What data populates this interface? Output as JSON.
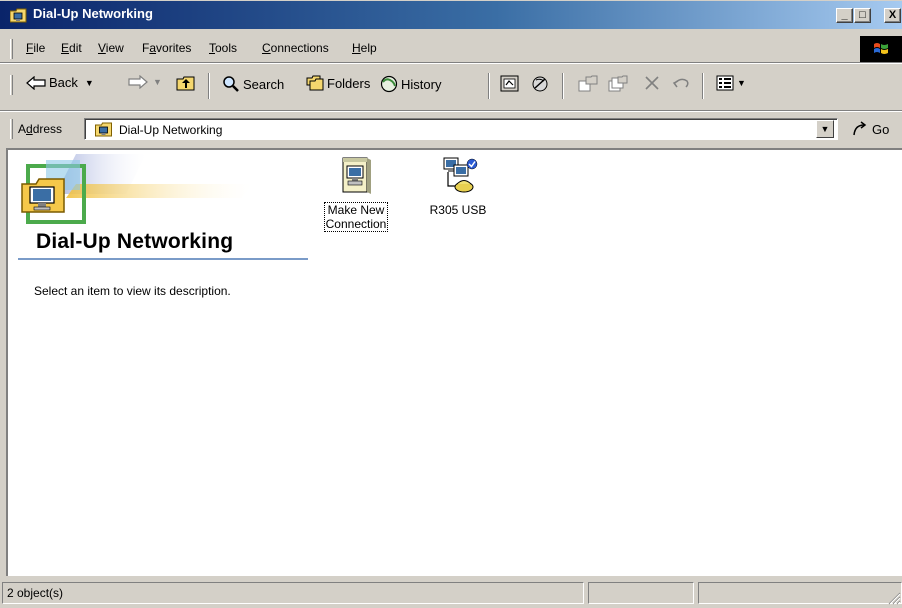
{
  "window": {
    "title": "Dial-Up Networking",
    "controls": {
      "minimize": "_",
      "maximize": "□",
      "close": "X"
    }
  },
  "menubar": {
    "items": [
      {
        "label": "File",
        "access_key": "F"
      },
      {
        "label": "Edit",
        "access_key": "E"
      },
      {
        "label": "View",
        "access_key": "V"
      },
      {
        "label": "Favorites",
        "access_key": "a"
      },
      {
        "label": "Tools",
        "access_key": "T"
      },
      {
        "label": "Connections",
        "access_key": "C"
      },
      {
        "label": "Help",
        "access_key": "H"
      }
    ]
  },
  "toolbar": {
    "back_label": "Back",
    "search_label": "Search",
    "folders_label": "Folders",
    "history_label": "History"
  },
  "addressbar": {
    "label": "Address",
    "value": "Dial-Up Networking",
    "go_label": "Go"
  },
  "content": {
    "folder_title": "Dial-Up Networking",
    "description_hint": "Select an item to view its description.",
    "items": [
      {
        "label_line1": "Make New",
        "label_line2": "Connection",
        "icon": "make-new-connection-icon"
      },
      {
        "label_line1": "R305 USB",
        "icon": "dial-up-connection-icon"
      }
    ]
  },
  "statusbar": {
    "object_count": "2 object(s)"
  },
  "colors": {
    "titlebar_start": "#0a246a",
    "titlebar_end": "#a6caf0",
    "face": "#d4d0c8",
    "title_rule": "#7a9bc8"
  }
}
